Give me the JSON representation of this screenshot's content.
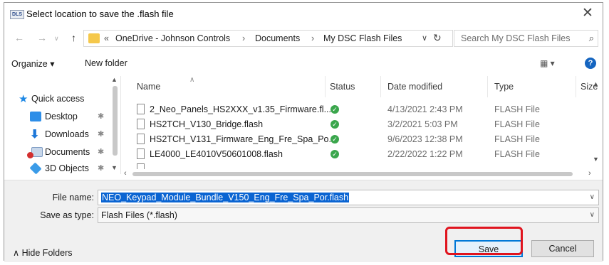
{
  "window": {
    "title": "Select location to save the .flash file",
    "icon_text": "DLS",
    "close_glyph": "✕"
  },
  "navbar": {
    "back_glyph": "←",
    "forward_glyph": "→",
    "up_glyph": "↑",
    "overflow": "«",
    "sep": "›",
    "breadcrumbs": [
      "OneDrive - Johnson Controls",
      "Documents",
      "My DSC Flash Files"
    ],
    "dropdown_glyph": "∨",
    "refresh_glyph": "↻",
    "search_placeholder": "Search My DSC Flash Files",
    "search_glyph": "⌕"
  },
  "toolbar": {
    "organize": "Organize ▾",
    "new_folder": "New folder",
    "view_glyph": "▦ ▾",
    "help_glyph": "?"
  },
  "sidebar": {
    "items": [
      {
        "label": "Quick access",
        "icon": "star-icon"
      },
      {
        "label": "Desktop",
        "icon": "desktop-folder-icon"
      },
      {
        "label": "Downloads",
        "icon": "download-icon"
      },
      {
        "label": "Documents",
        "icon": "documents-icon"
      },
      {
        "label": "3D Objects",
        "icon": "3d-objects-icon"
      }
    ],
    "pin_glyph": "✱"
  },
  "columns": {
    "name": "Name",
    "status": "Status",
    "date": "Date modified",
    "type": "Type",
    "size": "Size"
  },
  "files": [
    {
      "name": "2_Neo_Panels_HS2XXX_v1.35_Firmware.fl...",
      "status": "synced",
      "date": "4/13/2021 2:43 PM",
      "type": "FLASH File"
    },
    {
      "name": "HS2TCH_V130_Bridge.flash",
      "status": "synced",
      "date": "3/2/2021 5:03 PM",
      "type": "FLASH File"
    },
    {
      "name": "HS2TCH_V131_Firmware_Eng_Fre_Spa_Po...",
      "status": "synced",
      "date": "9/6/2023 12:38 PM",
      "type": "FLASH File"
    },
    {
      "name": "LE4000_LE4010V50601008.flash",
      "status": "synced",
      "date": "2/22/2022 1:22 PM",
      "type": "FLASH File"
    }
  ],
  "check_glyph": "✓",
  "form": {
    "file_name_label": "File name:",
    "file_name_value": "NEO_Keypad_Module_Bundle_V150_Eng_Fre_Spa_Por.flash",
    "save_as_label": "Save as type:",
    "save_as_value": "Flash Files (*.flash)",
    "dropdown_glyph": "∨"
  },
  "footer": {
    "hide_folders": "∧  Hide Folders",
    "save": "Save",
    "cancel": "Cancel"
  },
  "colors": {
    "selection": "#0a64d2",
    "highlight_box": "#e0141e",
    "sync_ok": "#3aa64c"
  }
}
